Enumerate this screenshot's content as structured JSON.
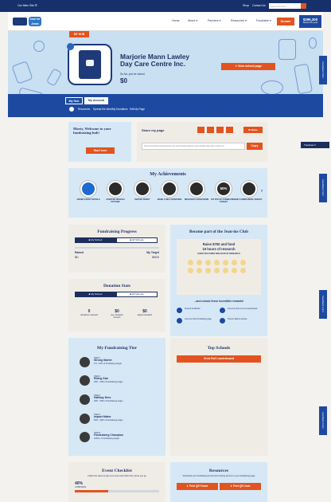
{
  "topbar": {
    "left": "Our Main Site ☰",
    "shop": "Shop",
    "contact": "Contact Us",
    "search_placeholder": "Search School"
  },
  "nav": {
    "logo_text": "Jean for Jeans",
    "items": [
      "Home",
      "About ▾",
      "Partners ▾",
      "Resources ▾",
      "Fundraise ▾"
    ],
    "donate": "Donate",
    "raised_value": "$396,300",
    "raised_label": "Raised this year"
  },
  "hero": {
    "my_hub": "MY HUB",
    "school_name": "Marjorie Mann Lawley Day Care Centre Inc.",
    "raised_so_far": "So far, you've raised",
    "amount": "$0",
    "view_school": "↗ View school page"
  },
  "tabs": {
    "active": "My Hub",
    "inactive": "My Account",
    "subnav": [
      "Resources",
      "Spread the Word",
      "My Donations",
      "Edit My Page"
    ]
  },
  "welcome": {
    "text": "Marty, Welcome to your fundraising hub!",
    "button": "Start here"
  },
  "share": {
    "label": "Share my page",
    "link": "https://fundraise.jeansforjeans.org.au/schools/marjorie-mann-lawley-day-care-centre-inc",
    "copy": "Copy",
    "more": "✉ Share"
  },
  "achievements": {
    "title": "My Achievements",
    "items": [
      "ADDED EVENT DETAILS",
      "UPDATED PROFILE PICTURE",
      "INVITED BUDDY",
      "MADE A SELF DONATION",
      "RECEIVED 5 DONATIONS",
      "HIT 50% OF FUNDRAISING TARGET",
      "HIT FUNDRAISING TARGET"
    ],
    "fifty": "50%"
  },
  "progress": {
    "title": "Fundraising Progress",
    "tab_on": "■ My School",
    "tab_off": "■ All Schools",
    "raised_label": "Raised",
    "target_label": "My Target",
    "raised": "$0",
    "target": "$500"
  },
  "club": {
    "title": "Become part of the Jean-ius Club",
    "raise": "Raise $750 and fund",
    "hours": "15 hours of research",
    "sub": "EVERY $50 FUNDS ONE HOUR OF RESEARCH",
    "unlock": "...and unlock these incredible rewards!",
    "rewards": [
      "Framed Certificate",
      "Jean-ius Club Fundraising page",
      "Jean-ius Club crest on leaderboard",
      "Honour Wall at website"
    ]
  },
  "donation": {
    "title": "Donation Stats",
    "tab_on": "■ My School",
    "tab_off": "■ All Schools",
    "stats": [
      {
        "v": "0",
        "l": "donations received"
      },
      {
        "v": "$0",
        "l": "avg. donation amount"
      },
      {
        "v": "$0",
        "l": "largest donation"
      }
    ]
  },
  "tier": {
    "title": "My Fundraising Tier",
    "items": [
      {
        "n": "TIER 1",
        "name": "Strong Starter",
        "d": "1% - 19% of fundraising target"
      },
      {
        "n": "TIER 2",
        "name": "Rising Star",
        "d": "20% - 39% of fundraising target"
      },
      {
        "n": "TIER 3",
        "name": "Halfway Hero",
        "d": "40% - 59% of fundraising target"
      },
      {
        "n": "TIER 4",
        "name": "Impact Maker",
        "d": "60% - 99% of fundraising target"
      },
      {
        "n": "TIER 5",
        "name": "Fundraising Champion",
        "d": "100%+ of fundraising target"
      }
    ]
  },
  "top": {
    "title": "Top Schools",
    "button": "View Full Leaderboard"
  },
  "checklist": {
    "title": "Event Checklist",
    "sub": "Follow the steps to plan your event and track them off as you go",
    "percent": "40%",
    "complete": "COMPLETE",
    "progress": 0.4
  },
  "resources": {
    "title": "Resources",
    "sub": "Download your fundraising kit and start inviting donors to your fundraising page",
    "poster": "⬇ Print QR Poster",
    "code": "⬇ Print QR Code"
  },
  "side": {
    "feedback": "Feedback Form",
    "translate": "Translate ▾"
  },
  "colors": {
    "navy": "#1c2e5e",
    "orange": "#e2531f",
    "blue": "#1d4aa0",
    "light": "#c9dff2"
  }
}
